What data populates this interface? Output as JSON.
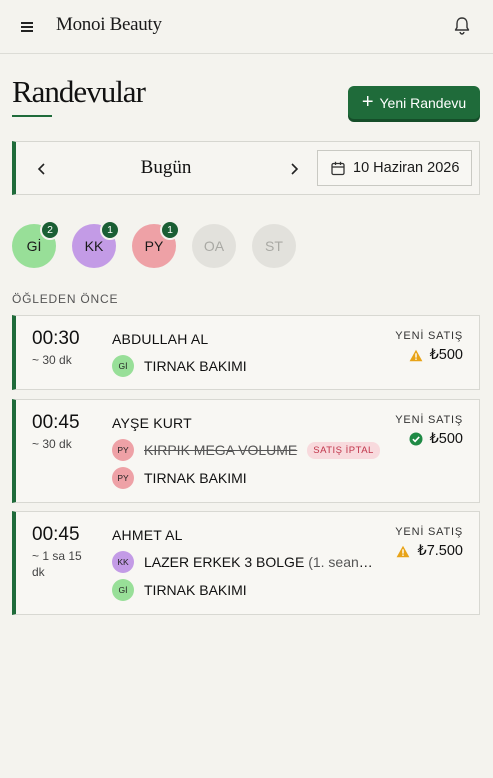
{
  "header": {
    "brand": "Monoi Beauty",
    "menu_icon": "hamburger-menu-icon",
    "bell_icon": "bell-icon"
  },
  "page": {
    "title": "Randevular",
    "new_button_label": "Yeni Randevu"
  },
  "datebar": {
    "today_label": "Bugün",
    "date_value": "10 Haziran 2026"
  },
  "staff": [
    {
      "initials": "Gİ",
      "count": "2",
      "color": "#98df98",
      "active": true
    },
    {
      "initials": "KK",
      "count": "1",
      "color": "#c39be6",
      "active": true
    },
    {
      "initials": "PY",
      "count": "1",
      "color": "#eea1a6",
      "active": true
    },
    {
      "initials": "OA",
      "count": "",
      "color": "#e2e1dc",
      "active": false
    },
    {
      "initials": "ST",
      "count": "",
      "color": "#e2e1dc",
      "active": false
    }
  ],
  "section_label": "ÖĞLEDEN ÖNCE",
  "appointments": [
    {
      "time": "00:30",
      "duration": "~ 30 dk",
      "customer": "ABDULLAH AL",
      "sale_label": "YENİ SATIŞ",
      "status_icon": "warning-icon",
      "price": "₺500",
      "services": [
        {
          "staff": "Gİ",
          "name": "TIRNAK BAKIMI"
        }
      ]
    },
    {
      "time": "00:45",
      "duration": "~ 30 dk",
      "customer": "AYŞE KURT",
      "sale_label": "YENİ SATIŞ",
      "status_icon": "check-circle-icon",
      "price": "₺500",
      "services": [
        {
          "staff": "PY",
          "name": "KIRPIK MEGA VOLUME",
          "cancel_tag": "SATIŞ İPTAL"
        },
        {
          "staff": "PY",
          "name": "TIRNAK BAKIMI"
        }
      ]
    },
    {
      "time": "00:45",
      "duration": "~ 1 sa 15 dk",
      "customer": "AHMET AL",
      "sale_label": "YENİ SATIŞ",
      "status_icon": "warning-icon",
      "price": "₺7.500",
      "services": [
        {
          "staff": "KK",
          "name": "LAZER ERKEK 3 BOLGE",
          "extra": "(1. seans / …"
        },
        {
          "staff": "Gİ",
          "name": "TIRNAK BAKIMI"
        }
      ]
    }
  ],
  "colors": {
    "accent": "#1f6b3a",
    "background": "#f4f3ee",
    "warning": "#e8a317",
    "success": "#1f8a45",
    "cancel": "#c0354a"
  }
}
